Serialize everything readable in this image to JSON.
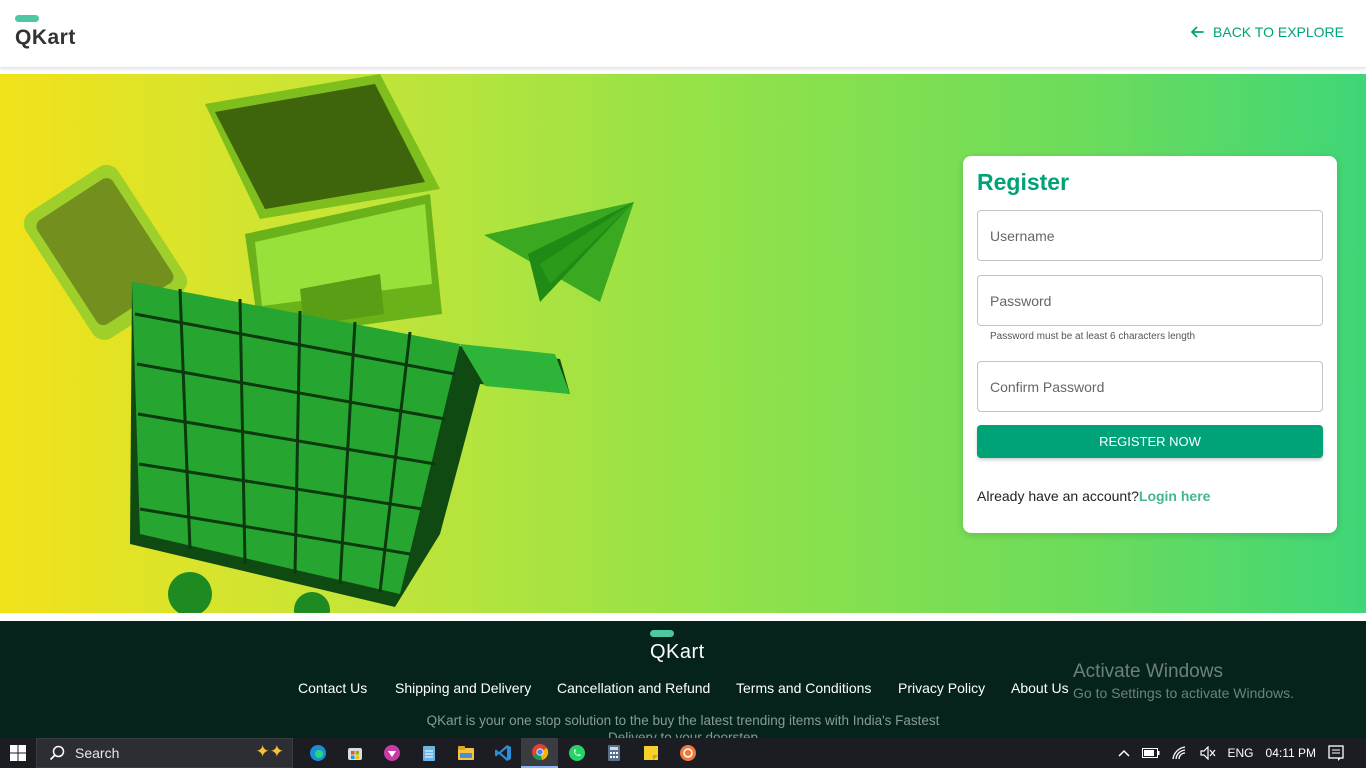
{
  "header": {
    "logo_text": "QKart",
    "back_label": "BACK TO EXPLORE"
  },
  "register": {
    "title": "Register",
    "username_placeholder": "Username",
    "password_placeholder": "Password",
    "password_helper": "Password must be at least 6 characters length",
    "confirm_placeholder": "Confirm Password",
    "button_label": "REGISTER NOW",
    "login_prompt": "Already have an account?",
    "login_link": "Login here"
  },
  "footer": {
    "logo_text": "QKart",
    "links": [
      "Contact Us",
      "Shipping and Delivery",
      "Cancellation and Refund",
      "Terms and Conditions",
      "Privacy Policy",
      "About Us"
    ],
    "description_line1": "QKart is your one stop solution to the buy the latest trending items with India's Fastest",
    "description_line2": "Delivery to your doorstep"
  },
  "watermark": {
    "line1": "Activate Windows",
    "line2": "Go to Settings to activate Windows."
  },
  "taskbar": {
    "search_label": "Search",
    "apps": [
      "edge-icon",
      "store-icon",
      "brave-icon",
      "notepad-icon",
      "explorer-icon",
      "vscode-icon",
      "chrome-icon",
      "whatsapp-icon",
      "calculator-icon",
      "sticky-notes-icon",
      "app-icon"
    ],
    "language": "ENG",
    "time": "04:11 PM"
  },
  "colors": {
    "accent": "#00a278",
    "footer_bg": "#05231a"
  }
}
